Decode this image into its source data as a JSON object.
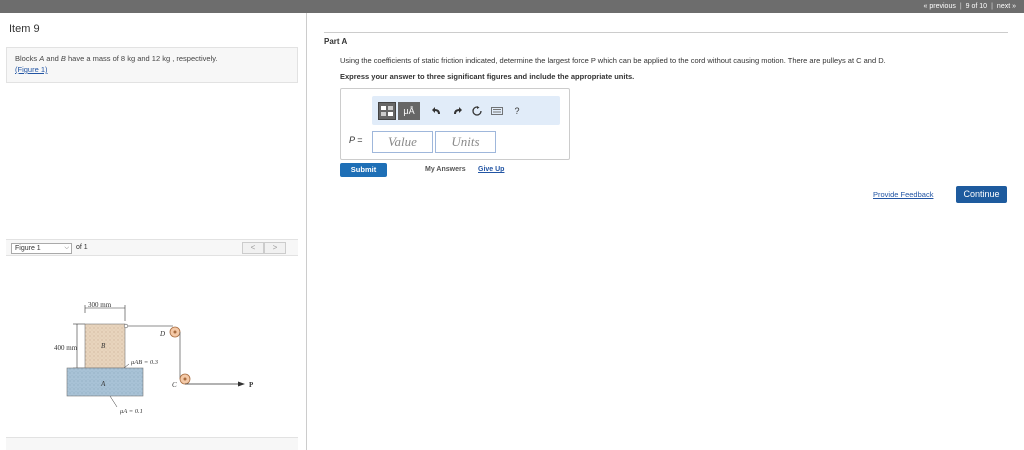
{
  "pager": {
    "previous": "« previous",
    "position": "9 of 10",
    "next": "next »"
  },
  "item_title": "Item 9",
  "problem": {
    "text_pre": "Blocks ",
    "a": "A",
    "text_mid": " and ",
    "b": "B",
    "text_post": " have a mass of 8 kg and 12 kg , respectively.",
    "figure_link": "(Figure 1)"
  },
  "figure_bar": {
    "select": "Figure 1",
    "of": "of 1",
    "prev": "<",
    "next": ">"
  },
  "figure": {
    "dim_width": "300 mm",
    "dim_height": "400 mm",
    "label_b": "B",
    "label_a": "A",
    "label_c": "C",
    "label_d": "D",
    "label_p": "P",
    "mu_ab": "μAB = 0.3",
    "mu_a": "μA = 0.1"
  },
  "part": {
    "title": "Part A"
  },
  "question": {
    "text": "Using the coefficients of static friction indicated, determine the largest force P which can be applied to the cord without causing motion. There are pulleys at C and D.",
    "instruction": "Express your answer to three significant figures and include the appropriate units."
  },
  "toolbar": {
    "mu_label": "μÅ",
    "help": "?"
  },
  "answer": {
    "label": "P =",
    "value_placeholder": "Value",
    "units_placeholder": "Units"
  },
  "actions": {
    "submit": "Submit",
    "my_answers": "My Answers",
    "give_up": "Give Up"
  },
  "footer": {
    "feedback": "Provide Feedback",
    "continue": "Continue"
  },
  "colors": {
    "accent": "#1e6fb6",
    "toolbar_bg": "#e1ecf9",
    "block_b": "#e8d4bd",
    "block_a": "#a8c2d6"
  }
}
